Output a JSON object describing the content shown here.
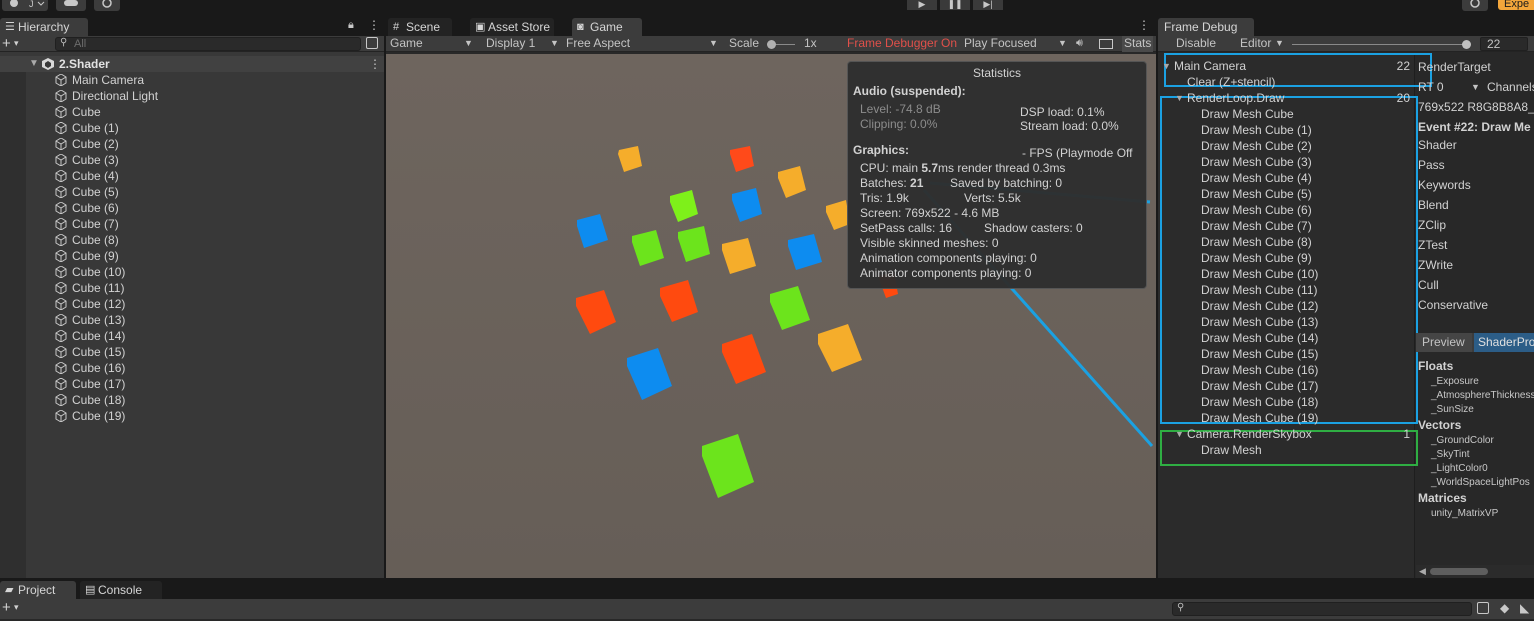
{
  "toolbar": {
    "experimental_label": "Expe"
  },
  "hierarchy": {
    "tab_label": "Hierarchy",
    "search_placeholder": "All",
    "scene_name": "2.Shader",
    "items": [
      "Main Camera",
      "Directional Light",
      "Cube",
      "Cube (1)",
      "Cube (2)",
      "Cube (3)",
      "Cube (4)",
      "Cube (5)",
      "Cube (6)",
      "Cube (7)",
      "Cube (8)",
      "Cube (9)",
      "Cube (10)",
      "Cube (11)",
      "Cube (12)",
      "Cube (13)",
      "Cube (14)",
      "Cube (15)",
      "Cube (16)",
      "Cube (17)",
      "Cube (18)",
      "Cube (19)"
    ]
  },
  "center_tabs": {
    "scene": "Scene",
    "asset_store": "Asset Store",
    "game": "Game"
  },
  "game_toolbar": {
    "view_select": "Game",
    "display_select": "Display 1",
    "aspect_select": "Free Aspect",
    "scale_label": "Scale",
    "scale_value": "1x",
    "frame_debugger_on": "Frame Debugger On",
    "play_focused": "Play Focused",
    "stats_label": "Stats"
  },
  "statistics": {
    "title": "Statistics",
    "audio_header": "Audio (suspended):",
    "level": "Level: -74.8 dB",
    "clipping": "Clipping: 0.0%",
    "dsp_load": "DSP load: 0.1%",
    "stream_load": "Stream load: 0.0%",
    "graphics_header": "Graphics:",
    "fps": "- FPS (Playmode Off",
    "cpu_prefix": "CPU: main ",
    "cpu_main": "5.7",
    "cpu_suffix": "ms  render thread 0.3ms",
    "batches_prefix": "Batches: ",
    "batches_value": "21",
    "saved_by_batching": "Saved by batching: 0",
    "tris": "Tris: 1.9k",
    "verts": "Verts: 5.5k",
    "screen": "Screen: 769x522 - 4.6 MB",
    "setpass": "SetPass calls: 16",
    "shadow_casters": "Shadow casters: 0",
    "skinned": "Visible skinned meshes: 0",
    "animation": "Animation components playing: 0",
    "animator": "Animator components playing: 0"
  },
  "frame_debug": {
    "tab_label": "Frame Debug",
    "disable_button": "Disable",
    "editor_select": "Editor",
    "event_value": "22",
    "events": [
      {
        "label": "Main Camera",
        "count": "22"
      },
      {
        "label": "Clear (Z+stencil)",
        "count": ""
      },
      {
        "label": "RenderLoop.Draw",
        "count": "20"
      },
      {
        "label": "Draw Mesh Cube",
        "count": ""
      },
      {
        "label": "Draw Mesh Cube (1)",
        "count": ""
      },
      {
        "label": "Draw Mesh Cube (2)",
        "count": ""
      },
      {
        "label": "Draw Mesh Cube (3)",
        "count": ""
      },
      {
        "label": "Draw Mesh Cube (4)",
        "count": ""
      },
      {
        "label": "Draw Mesh Cube (5)",
        "count": ""
      },
      {
        "label": "Draw Mesh Cube (6)",
        "count": ""
      },
      {
        "label": "Draw Mesh Cube (7)",
        "count": ""
      },
      {
        "label": "Draw Mesh Cube (8)",
        "count": ""
      },
      {
        "label": "Draw Mesh Cube (9)",
        "count": ""
      },
      {
        "label": "Draw Mesh Cube (10)",
        "count": ""
      },
      {
        "label": "Draw Mesh Cube (11)",
        "count": ""
      },
      {
        "label": "Draw Mesh Cube (12)",
        "count": ""
      },
      {
        "label": "Draw Mesh Cube (13)",
        "count": ""
      },
      {
        "label": "Draw Mesh Cube (14)",
        "count": ""
      },
      {
        "label": "Draw Mesh Cube (15)",
        "count": ""
      },
      {
        "label": "Draw Mesh Cube (16)",
        "count": ""
      },
      {
        "label": "Draw Mesh Cube (17)",
        "count": ""
      },
      {
        "label": "Draw Mesh Cube (18)",
        "count": ""
      },
      {
        "label": "Draw Mesh Cube (19)",
        "count": ""
      },
      {
        "label": "Camera.RenderSkybox",
        "count": "1"
      },
      {
        "label": "Draw Mesh",
        "count": ""
      }
    ],
    "details": {
      "render_target": "RenderTarget",
      "rt_select": "RT 0",
      "channels": "Channels",
      "format": "769x522 R8G8B8A8_",
      "event_title": "Event #22: Draw Me",
      "props": [
        "Shader",
        "Pass",
        "Keywords",
        "Blend",
        "ZClip",
        "ZTest",
        "ZWrite",
        "Cull",
        "Conservative"
      ],
      "tab_preview": "Preview",
      "tab_shaderprops": "ShaderPro",
      "floats_header": "Floats",
      "floats": [
        "_Exposure",
        "_AtmosphereThickness",
        "_SunSize"
      ],
      "vectors_header": "Vectors",
      "vectors": [
        "_GroundColor",
        "_SkyTint",
        "_LightColor0",
        "_WorldSpaceLightPos"
      ],
      "matrices_header": "Matrices",
      "matrices": [
        "unity_MatrixVP"
      ]
    }
  },
  "bottom": {
    "project_tab": "Project",
    "console_tab": "Console"
  },
  "colors": {
    "highlight_blue": "#1ba1e2",
    "highlight_green": "#2fae43",
    "accent_orange": "#f3a63b"
  }
}
